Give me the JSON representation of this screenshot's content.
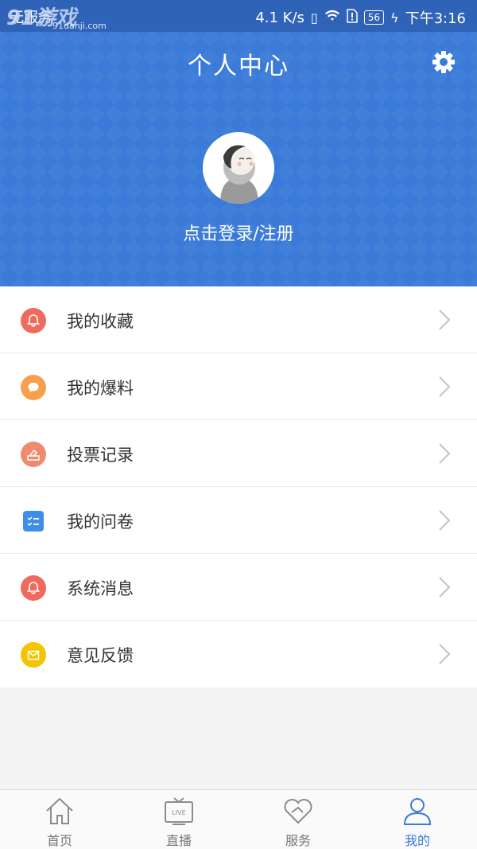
{
  "status_bar": {
    "carrier": "无服务",
    "watermark": "91游戏",
    "watermark_sub": "91danji.com",
    "speed": "4.1 K/s",
    "battery": "56",
    "time": "下午3:16"
  },
  "header": {
    "title": "个人中心",
    "login_text": "点击登录/注册"
  },
  "menu": {
    "items": [
      {
        "label": "我的收藏",
        "icon": "bell-icon",
        "color": "#ef6b5e"
      },
      {
        "label": "我的爆料",
        "icon": "chat-bubble-icon",
        "color": "#f6a04d"
      },
      {
        "label": "投票记录",
        "icon": "ballot-icon",
        "color": "#f08a6d"
      },
      {
        "label": "我的问卷",
        "icon": "checklist-icon",
        "color": "#3d8ee8"
      },
      {
        "label": "系统消息",
        "icon": "bell-icon",
        "color": "#ef6b5e"
      },
      {
        "label": "意见反馈",
        "icon": "envelope-icon",
        "color": "#f5c400"
      }
    ]
  },
  "bottom_nav": {
    "items": [
      {
        "label": "首页",
        "icon": "home-icon"
      },
      {
        "label": "直播",
        "icon": "tv-live-icon",
        "tv_text": "LIVE"
      },
      {
        "label": "服务",
        "icon": "heart-icon"
      },
      {
        "label": "我的",
        "icon": "person-icon"
      }
    ],
    "active": "我的"
  },
  "colors": {
    "brand": "#3a7ad8",
    "active_tab": "#3a7ad8"
  }
}
